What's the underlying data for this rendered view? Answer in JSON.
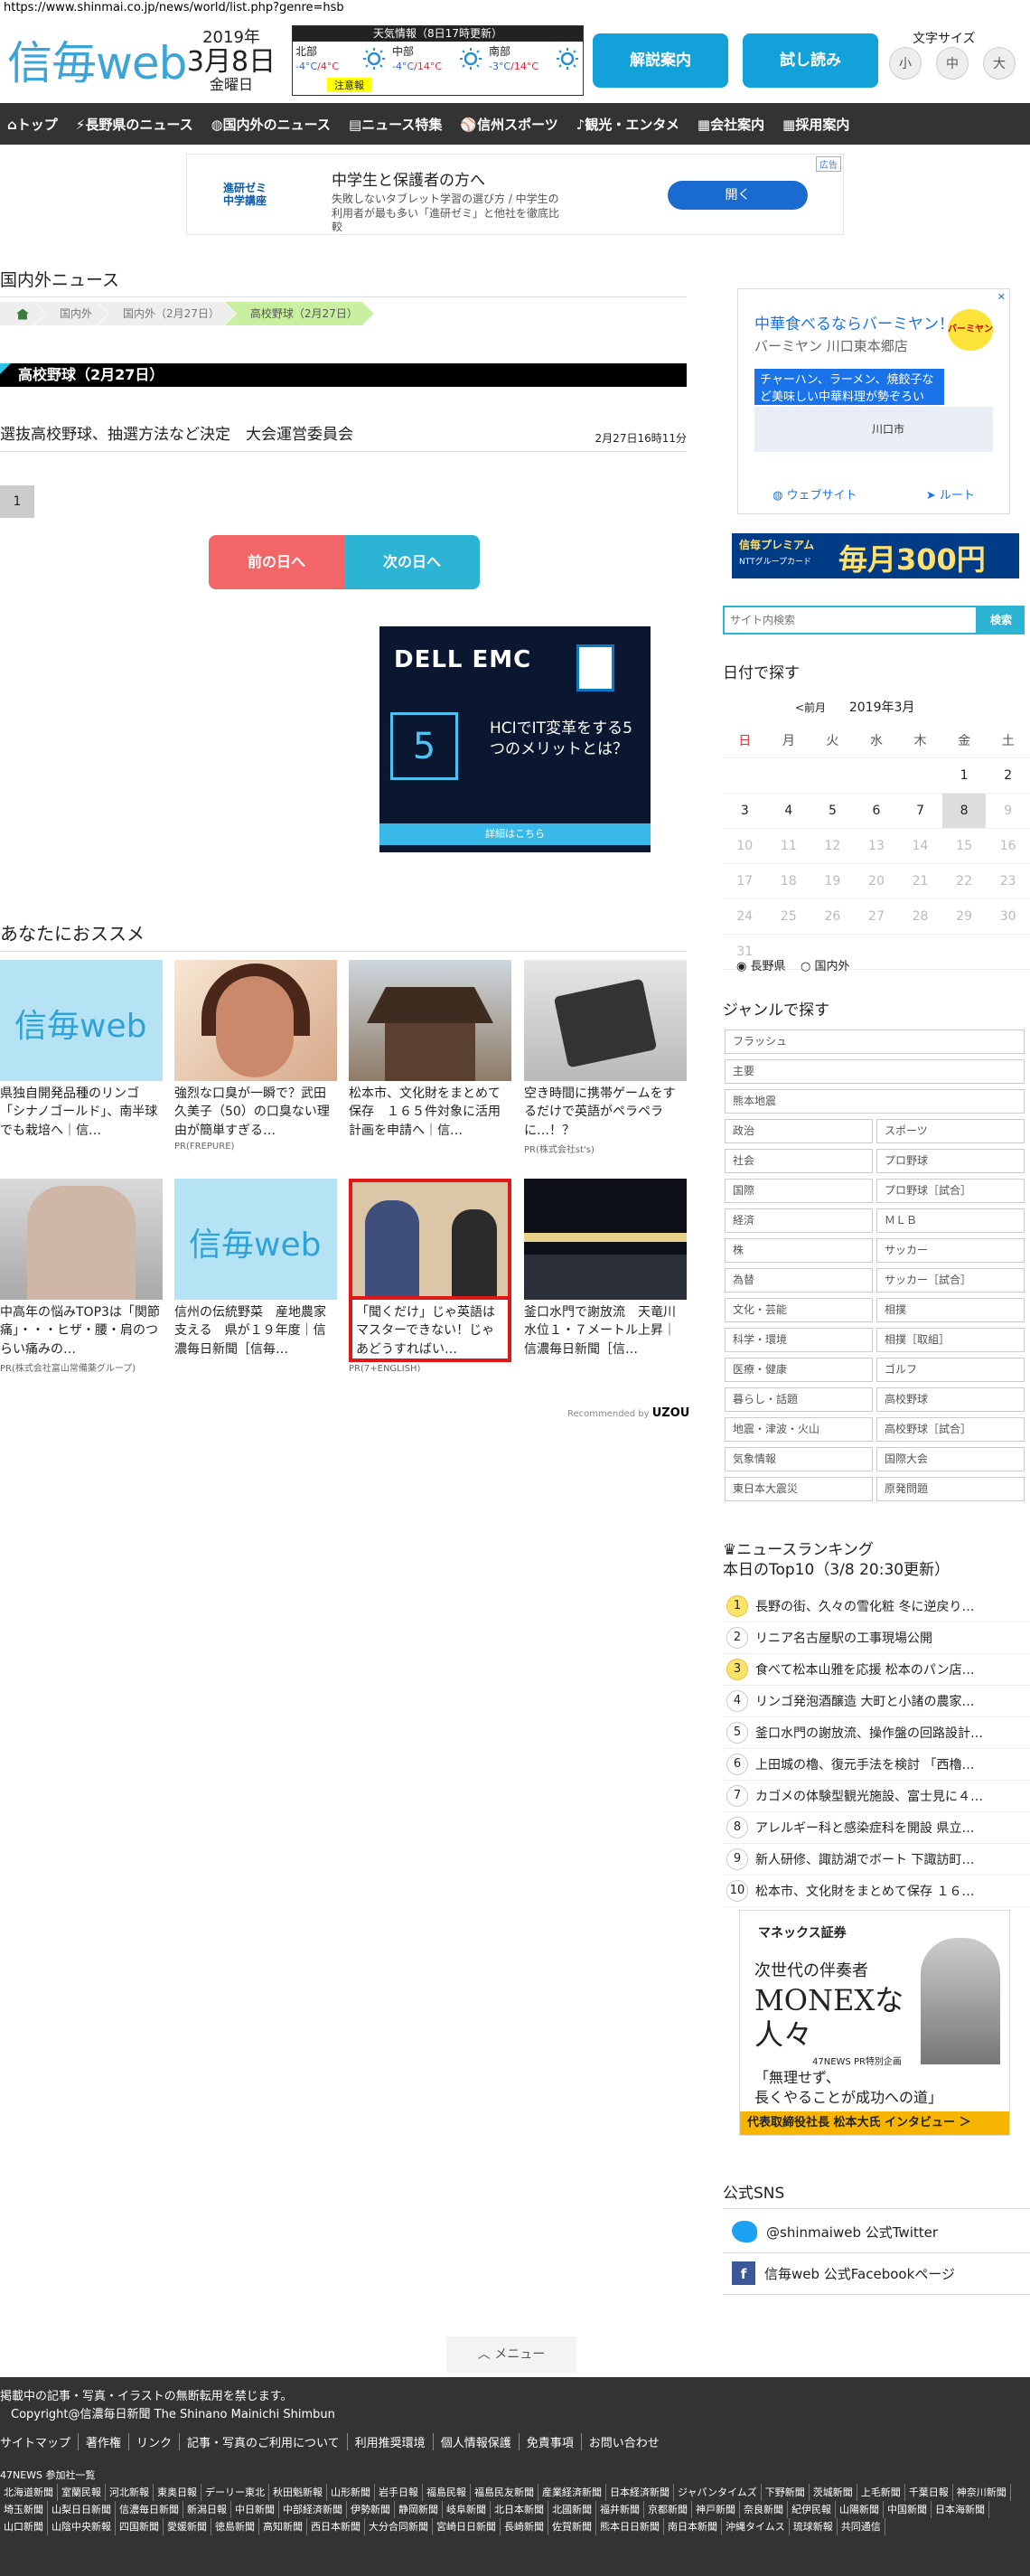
{
  "browser": {
    "url": "https://www.shinmai.co.jp/news/world/list.php?genre=hsb"
  },
  "header": {
    "logo": "信毎web",
    "date": {
      "year": "2019年",
      "day": "3月8日",
      "weekday": "金曜日"
    },
    "weather": {
      "title": "天気情報（8日17時更新）",
      "regions": [
        {
          "name": "北部",
          "hi": "4°C",
          "lo": "-4°C",
          "sep": "/",
          "warning": "注意報"
        },
        {
          "name": "中部",
          "hi": "14°C",
          "lo": "-4°C",
          "sep": "/"
        },
        {
          "name": "南部",
          "hi": "14°C",
          "lo": "-3°C",
          "sep": "/"
        }
      ]
    },
    "btn_kaisetsu": "解説案内",
    "btn_tameshi": "試し読み",
    "font_size_label": "文字サイズ",
    "font_sizes": [
      "小",
      "中",
      "大"
    ]
  },
  "nav": [
    "トップ",
    "長野県のニュース",
    "国内外のニュース",
    "ニュース特集",
    "信州スポーツ",
    "観光・エンタメ",
    "会社案内",
    "採用案内"
  ],
  "top_ad": {
    "tag": "広告",
    "brand": "進研ゼミ\n中学講座",
    "headline": "中学生と保護者の方へ",
    "body": "失敗しないタブレット学習の選び方 / 中学生の利用者が最も多い「進研ゼミ」と他社を徹底比較",
    "cta": "開く"
  },
  "main": {
    "section_title": "国内外ニュース",
    "breadcrumbs": [
      "国内外",
      "国内外（2月27日）",
      "高校野球（2月27日）"
    ],
    "category_heading": "高校野球（2月27日）",
    "article": {
      "title": "選抜高校野球、抽選方法など決定　大会運営委員会",
      "time": "2月27日16時11分"
    },
    "page": "1",
    "prev_day": "前の日へ",
    "next_day": "次の日へ",
    "dell_ad": {
      "brand": "DELL EMC",
      "num": "5",
      "message": "HCIでIT変革をする5つのメリットとは？",
      "cta": "詳細はこちら"
    },
    "rec_title": "あなたにおススメ",
    "rec_cards": [
      {
        "img": "shinmai",
        "text": "県独自開発品種のリンゴ「シナノゴールド」、南半球でも栽培へ｜信…",
        "pr": ""
      },
      {
        "img": "face",
        "text": "強烈な口臭が一瞬で？武田久美子（50）の口臭ない理由が簡単すぎる…",
        "pr": "PR(FREPURE)"
      },
      {
        "img": "temple",
        "text": "松本市、文化財をまとめて保存　１６５件対象に活用計画を申請へ｜信…",
        "pr": ""
      },
      {
        "img": "game",
        "text": "空き時間に携帯ゲームをするだけで英語がペラペラに…！？",
        "pr": "PR(株式会社st's)"
      },
      {
        "img": "back",
        "text": "中高年の悩みTOP3は「関節痛」・・・ヒザ・腰・肩のつらい痛みの…",
        "pr": "PR(株式会社富山常備薬グループ)"
      },
      {
        "img": "shinmai",
        "text": "信州の伝統野菜　産地農家支える　県が１９年度｜信濃毎日新聞［信毎…",
        "pr": ""
      },
      {
        "img": "talk",
        "text": "「聞くだけ」じゃ英語はマスターできない！じゃあどうすればい…",
        "pr": "PR(7+ENGLISH)"
      },
      {
        "img": "night",
        "text": "釜口水門で謝放流　天竜川水位１・７メートル上昇｜信濃毎日新聞［信…",
        "pr": ""
      }
    ],
    "recommended_by": "Recommended by",
    "recommended_brand": "UZOU"
  },
  "sidebar": {
    "map_ad": {
      "close": "✕",
      "headline": "中華食べるならバーミヤン！",
      "sub": "バーミヤン 川口東本郷店",
      "promo": "チャーハン、ラーメン、焼餃子など美味しい中華料理が勢ぞろい",
      "location": "川口市",
      "logo": "バーミヤン",
      "website": "ウェブサイト",
      "route": "ルート"
    },
    "premium_ad": {
      "p1": "信毎プレミアム",
      "p2": "NTTグループカード",
      "p3": "毎月300円"
    },
    "search_placeholder": "サイト内検索",
    "search_btn": "検索",
    "calendar": {
      "title": "日付で探す",
      "prev": "<前月",
      "month": "2019年3月",
      "weekdays": [
        "日",
        "月",
        "火",
        "水",
        "木",
        "金",
        "土"
      ],
      "weeks": [
        [
          "",
          "",
          "",
          "",
          "",
          "1",
          "2"
        ],
        [
          "3",
          "4",
          "5",
          "6",
          "7",
          "8",
          "9"
        ],
        [
          "10",
          "11",
          "12",
          "13",
          "14",
          "15",
          "16"
        ],
        [
          "17",
          "18",
          "19",
          "20",
          "21",
          "22",
          "23"
        ],
        [
          "24",
          "25",
          "26",
          "27",
          "28",
          "29",
          "30"
        ],
        [
          "31",
          "",
          "",
          "",
          "",
          "",
          ""
        ]
      ],
      "radio1": "長野県",
      "radio2": "国内外"
    },
    "genre_title": "ジャンルで探す",
    "genres_full": [
      "フラッシュ",
      "主要",
      "熊本地震"
    ],
    "genres": [
      "政治",
      "スポーツ",
      "社会",
      "プロ野球",
      "国際",
      "プロ野球［試合］",
      "経済",
      "ＭＬＢ",
      "株",
      "サッカー",
      "為替",
      "サッカー［試合］",
      "文化・芸能",
      "相撲",
      "科学・環境",
      "相撲［取組］",
      "医療・健康",
      "ゴルフ",
      "暮らし・話題",
      "高校野球",
      "地震・津波・火山",
      "高校野球［試合］",
      "気象情報",
      "国際大会",
      "東日本大震災",
      "原発問題"
    ],
    "ranking_title": "ニュースランキング",
    "ranking_sub": "本日のTop10（3/8 20:30更新）",
    "ranking": [
      "長野の街、久々の雪化粧 冬に逆戻り…",
      "リニア名古屋駅の工事現場公開",
      "食べて松本山雅を応援 松本のパン店…",
      "リンゴ発泡酒醸造 大町と小諸の農家…",
      "釜口水門の謝放流、操作盤の回路設計…",
      "上田城の櫓、復元手法を検討 「西櫓…",
      "カゴメの体験型観光施設、富士見に４…",
      "アレルギー科と感染症科を開設 県立…",
      "新人研修、諏訪湖でボート 下諏訪町…",
      "松本市、文化財をまとめて保存 １６…"
    ],
    "monex_ad": {
      "brand": "マネックス証券",
      "sub": "次世代の伴奏者",
      "main": "MONEXな人々",
      "small": "47NEWS PR特別企画",
      "quote": "「無理せず、\n長くやることが成功への道」",
      "footer": "代表取締役社長 松本大氏 インタビュー ＞"
    },
    "sns_title": "公式SNS",
    "twitter": "@shinmaiweb 公式Twitter",
    "facebook": "信毎web 公式Facebookページ"
  },
  "menu_label": "メニュー",
  "footer": {
    "notice": "掲載中の記事・写真・イラストの無断転用を禁じます。",
    "copyright": "Copyright@信濃毎日新聞 The Shinano Mainichi Shimbun",
    "links": [
      "サイトマップ",
      "著作権",
      "リンク",
      "記事・写真のご利用について",
      "利用推奨環境",
      "個人情報保護",
      "免責事項",
      "お問い合わせ"
    ],
    "papers_title": "47NEWS 参加社一覧",
    "papers": [
      "北海道新聞",
      "室蘭民報",
      "河北新報",
      "東奥日報",
      "デーリー東北",
      "秋田魁新報",
      "山形新聞",
      "岩手日報",
      "福島民報",
      "福島民友新聞",
      "産業経済新聞",
      "日本経済新聞",
      "ジャパンタイムズ",
      "下野新聞",
      "茨城新聞",
      "上毛新聞",
      "千葉日報",
      "神奈川新聞",
      "埼玉新聞",
      "山梨日日新聞",
      "信濃毎日新聞",
      "新潟日報",
      "中日新聞",
      "中部経済新聞",
      "伊勢新聞",
      "静岡新聞",
      "岐阜新聞",
      "北日本新聞",
      "北國新聞",
      "福井新聞",
      "京都新聞",
      "神戸新聞",
      "奈良新聞",
      "紀伊民報",
      "山陽新聞",
      "中国新聞",
      "日本海新聞",
      "山口新聞",
      "山陰中央新報",
      "四国新聞",
      "愛媛新聞",
      "徳島新聞",
      "高知新聞",
      "西日本新聞",
      "大分合同新聞",
      "宮崎日日新聞",
      "長崎新聞",
      "佐賀新聞",
      "熊本日日新聞",
      "南日本新聞",
      "沖縄タイムス",
      "琉球新報",
      "共同通信"
    ]
  }
}
